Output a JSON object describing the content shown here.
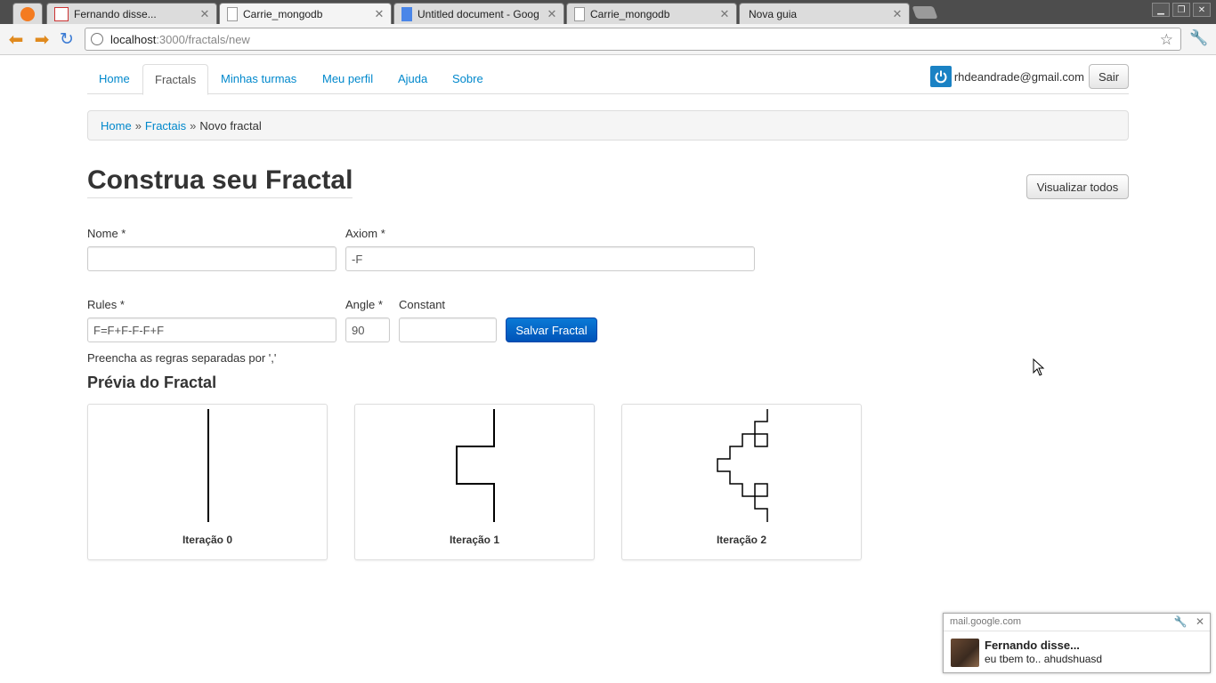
{
  "browser": {
    "tabs": [
      {
        "title": "",
        "icon": "app-icon"
      },
      {
        "title": "Fernando disse...",
        "icon": "gmail-icon"
      },
      {
        "title": "Carrie_mongodb",
        "icon": "page-icon",
        "active": true
      },
      {
        "title": "Untitled document - Goog",
        "icon": "docs-icon"
      },
      {
        "title": "Carrie_mongodb",
        "icon": "page-icon"
      },
      {
        "title": "Nova guia",
        "icon": ""
      }
    ],
    "url_host": "localhost",
    "url_path": ":3000/fractals/new"
  },
  "nav": {
    "tabs": [
      "Home",
      "Fractals",
      "Minhas turmas",
      "Meu perfil",
      "Ajuda",
      "Sobre"
    ],
    "active": "Fractals",
    "user_email": "rhdeandrade@gmail.com",
    "logout_label": "Sair"
  },
  "breadcrumb": {
    "home": "Home",
    "sep": "»",
    "fractais": "Fractais",
    "current": "Novo fractal"
  },
  "page": {
    "title": "Construa seu Fractal",
    "view_all_label": "Visualizar todos"
  },
  "form": {
    "nome_label": "Nome *",
    "nome_value": "",
    "axiom_label": "Axiom *",
    "axiom_value": "-F",
    "rules_label": "Rules *",
    "rules_value": "F=F+F-F-F+F",
    "angle_label": "Angle *",
    "angle_value": "90",
    "constant_label": "Constant",
    "constant_value": "",
    "save_label": "Salvar Fractal",
    "help_text": "Preencha as regras separadas por ','"
  },
  "preview": {
    "title": "Prévia do Fractal",
    "captions": [
      "Iteração 0",
      "Iteração 1",
      "Iteração 2"
    ]
  },
  "notification": {
    "source": "mail.google.com",
    "title": "Fernando disse...",
    "message": "eu tbem to.. ahudshuasd"
  },
  "colors": {
    "link": "#0088cc",
    "primary_button": "#0062cc",
    "tabstrip": "#4d4d4d"
  }
}
